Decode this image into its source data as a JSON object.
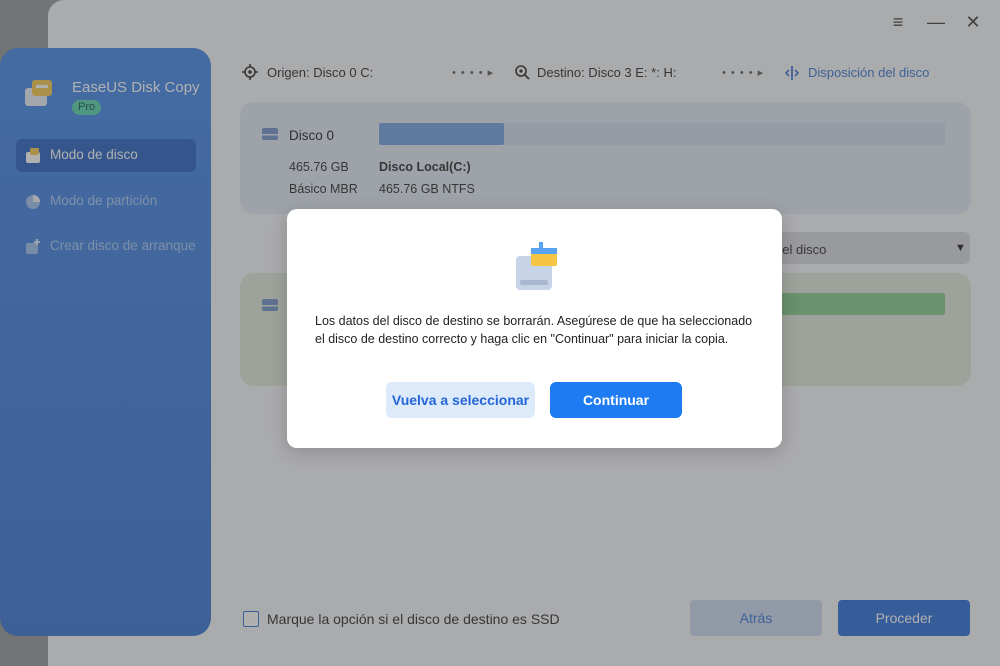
{
  "window_controls": {
    "menu": "≡",
    "minimize": "—",
    "close": "✕"
  },
  "app": {
    "name": "EaseUS Disk Copy",
    "badge": "Pro"
  },
  "sidebar": {
    "items": [
      {
        "label": "Modo de disco",
        "active": true
      },
      {
        "label": "Modo de partición",
        "active": false
      },
      {
        "label": "Crear disco de arranque",
        "active": false
      }
    ]
  },
  "topbar": {
    "source": "Origen: Disco 0 C:",
    "arrow": "• • • • ▸",
    "destination": "Destino: Disco 3 E: *: H:",
    "layout_link": "Disposición del disco"
  },
  "source_disk": {
    "name": "Disco 0",
    "size": "465.76 GB",
    "type": "Básico MBR",
    "partition_name": "Disco Local(C:)",
    "partition_info": "465.76 GB NTFS",
    "used_fraction": 0.22
  },
  "dropdown": {
    "value": "del disco"
  },
  "footer": {
    "ssd_checkbox_label": "Marque la opción si el disco de destino es SSD",
    "back_label": "Atrás",
    "proceed_label": "Proceder"
  },
  "dialog": {
    "message": "Los datos del disco de destino se borrarán.  Asegúrese de que ha seleccionado el disco de destino correcto y haga clic en \"Continuar\" para iniciar la copia.",
    "reselect_label": "Vuelva a seleccionar",
    "continue_label": "Continuar"
  },
  "colors": {
    "accent": "#1f7bf2",
    "sidebar": "#3b82e6",
    "source_card": "#dfe6f2",
    "dest_card": "#dde8d7"
  }
}
